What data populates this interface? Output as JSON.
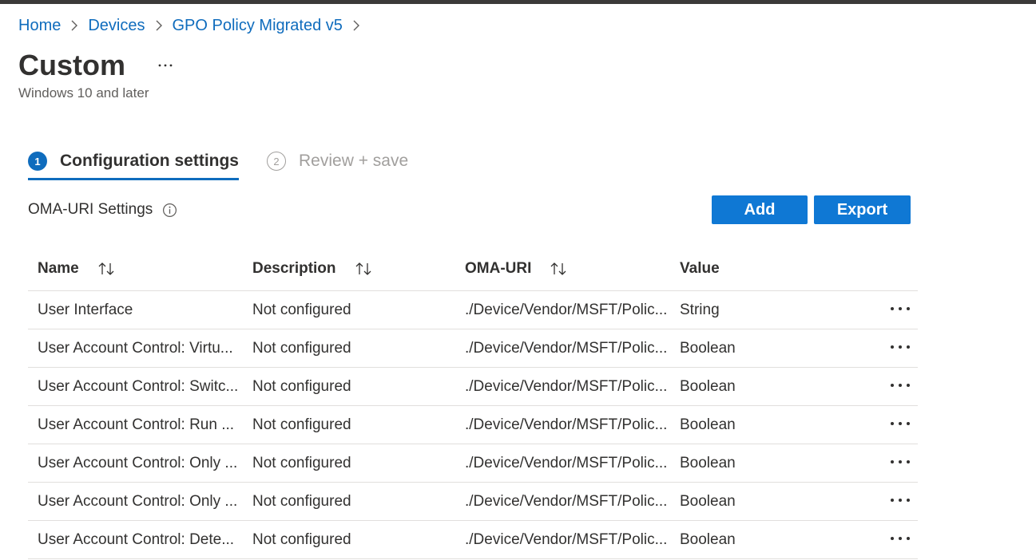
{
  "breadcrumb": {
    "items": [
      "Home",
      "Devices",
      "GPO Policy Migrated v5"
    ]
  },
  "header": {
    "title": "Custom",
    "subtitle": "Windows 10 and later"
  },
  "steps": [
    {
      "number": "1",
      "label": "Configuration settings",
      "state": "active"
    },
    {
      "number": "2",
      "label": "Review + save",
      "state": "inactive"
    }
  ],
  "settings": {
    "label": "OMA-URI Settings",
    "add_label": "Add",
    "export_label": "Export"
  },
  "table": {
    "columns": [
      "Name",
      "Description",
      "OMA-URI",
      "Value"
    ],
    "rows": [
      {
        "name": "User Interface",
        "description": "Not configured",
        "oma_uri": "./Device/Vendor/MSFT/Polic...",
        "value": "String"
      },
      {
        "name": "User Account Control: Virtu...",
        "description": "Not configured",
        "oma_uri": "./Device/Vendor/MSFT/Polic...",
        "value": "Boolean"
      },
      {
        "name": "User Account Control: Switc...",
        "description": "Not configured",
        "oma_uri": "./Device/Vendor/MSFT/Polic...",
        "value": "Boolean"
      },
      {
        "name": "User Account Control: Run ...",
        "description": "Not configured",
        "oma_uri": "./Device/Vendor/MSFT/Polic...",
        "value": "Boolean"
      },
      {
        "name": "User Account Control: Only ...",
        "description": "Not configured",
        "oma_uri": "./Device/Vendor/MSFT/Polic...",
        "value": "Boolean"
      },
      {
        "name": "User Account Control: Only ...",
        "description": "Not configured",
        "oma_uri": "./Device/Vendor/MSFT/Polic...",
        "value": "Boolean"
      },
      {
        "name": "User Account Control: Dete...",
        "description": "Not configured",
        "oma_uri": "./Device/Vendor/MSFT/Polic...",
        "value": "Boolean"
      }
    ]
  },
  "colors": {
    "accent": "#0f6cbd",
    "button": "#0f78d4",
    "text": "#323130",
    "muted": "#a19f9d",
    "border": "#e1dfdd"
  },
  "icons": {
    "breadcrumb_separator": "chevron-right-icon",
    "title_more": "more-horizontal-icon",
    "info": "info-icon",
    "sort": "sort-icon",
    "row_more": "more-horizontal-icon"
  }
}
